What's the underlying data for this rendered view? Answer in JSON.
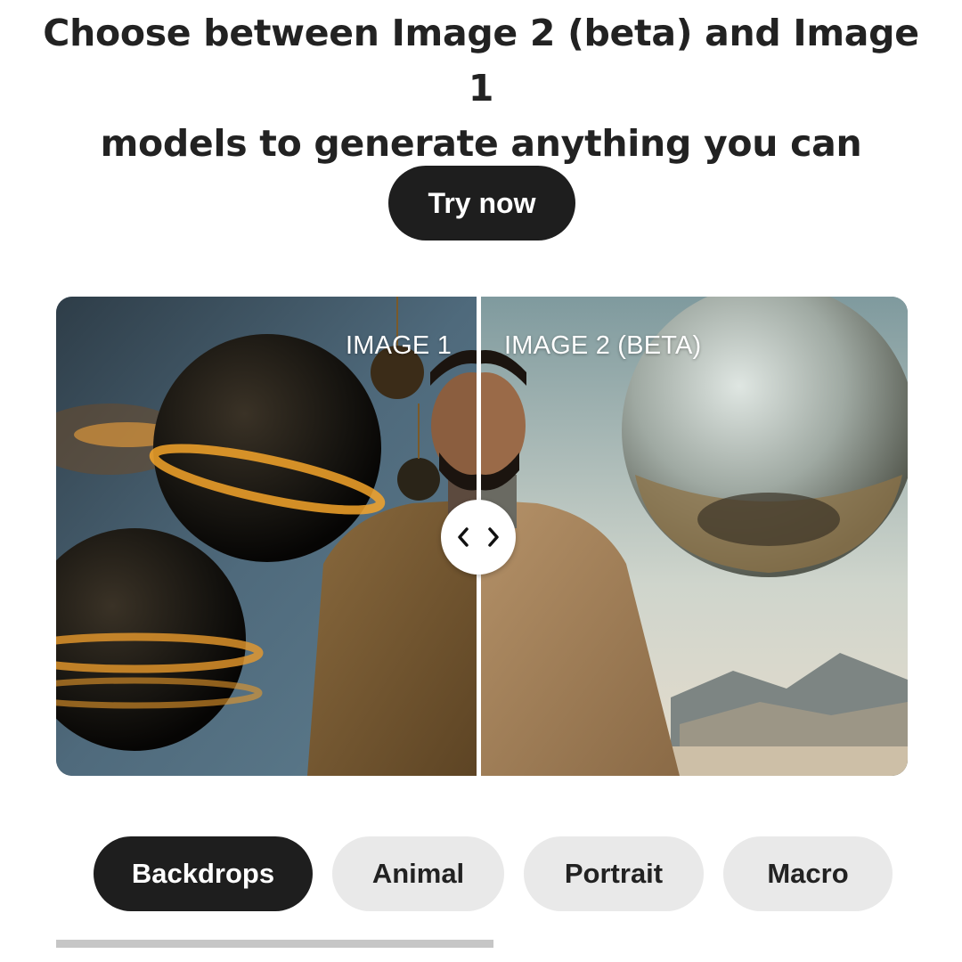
{
  "headline": {
    "line1": "Choose between Image 2 (beta) and Image 1",
    "line2": "models to generate anything you can imagine."
  },
  "cta": {
    "label": "Try now"
  },
  "comparison": {
    "left_label": "IMAGE 1",
    "right_label": "IMAGE 2 (BETA)",
    "slider_position": 0.5,
    "handle_icon": "chevron-left-right-icon"
  },
  "categories": {
    "items": [
      {
        "label": "Backdrops",
        "active": true
      },
      {
        "label": "Animal",
        "active": false
      },
      {
        "label": "Portrait",
        "active": false
      },
      {
        "label": "Macro",
        "active": false
      }
    ]
  },
  "colors": {
    "dark": "#1e1e1e",
    "chip_inactive": "#e9e9e9",
    "scrollbar": "#c6c6c6"
  }
}
